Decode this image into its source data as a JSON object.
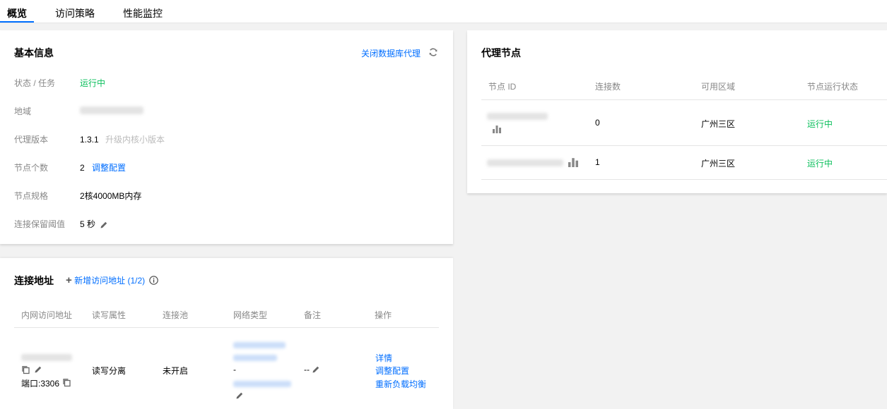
{
  "tabs": [
    {
      "label": "概览"
    },
    {
      "label": "访问策略"
    },
    {
      "label": "性能监控"
    }
  ],
  "basic_info": {
    "title": "基本信息",
    "close_proxy_label": "关闭数据库代理",
    "rows": {
      "status_label": "状态 / 任务",
      "status_value": "运行中",
      "region_label": "地域",
      "version_label": "代理版本",
      "version_value": "1.3.1",
      "upgrade_label": "升级内核小版本",
      "node_count_label": "节点个数",
      "node_count_value": "2",
      "adjust_config_label": "调整配置",
      "node_spec_label": "节点规格",
      "node_spec_value": "2核4000MB内存",
      "keepalive_label": "连接保留阈值",
      "keepalive_value": "5 秒"
    }
  },
  "proxy_nodes": {
    "title": "代理节点",
    "columns": [
      "节点 ID",
      "连接数",
      "可用区域",
      "节点运行状态"
    ],
    "rows": [
      {
        "connections": "0",
        "zone": "广州三区",
        "status": "运行中"
      },
      {
        "connections": "1",
        "zone": "广州三区",
        "status": "运行中"
      }
    ]
  },
  "connection": {
    "title": "连接地址",
    "add_label": "新增访问地址 (1/2)",
    "columns": [
      "内网访问地址",
      "读写属性",
      "连接池",
      "网络类型",
      "备注",
      "操作"
    ],
    "row": {
      "port": "端口:3306",
      "rw": "读写分离",
      "pool": "未开启",
      "network_dash": "-",
      "remark": "--",
      "actions": [
        "详情",
        "调整配置",
        "重新负载均衡"
      ]
    }
  },
  "colors": {
    "accent": "#006eff",
    "running": "#0abf5b",
    "label": "#888888"
  }
}
